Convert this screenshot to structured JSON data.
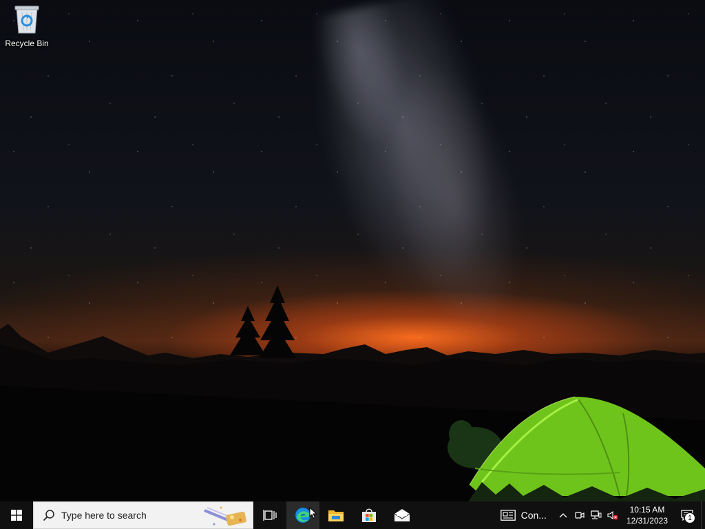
{
  "desktop": {
    "icons": [
      {
        "label": "Recycle Bin",
        "icon": "recycle-bin-icon"
      }
    ]
  },
  "taskbar": {
    "start_icon": "windows-logo-icon",
    "search": {
      "placeholder": "Type here to search",
      "icon": "search-icon"
    },
    "pinned": [
      {
        "name": "Task View",
        "icon": "task-view-icon"
      },
      {
        "name": "Microsoft Edge",
        "icon": "edge-icon",
        "active": true
      },
      {
        "name": "File Explorer",
        "icon": "file-explorer-icon"
      },
      {
        "name": "Microsoft Store",
        "icon": "store-icon"
      },
      {
        "name": "Mail",
        "icon": "mail-icon"
      }
    ],
    "news": {
      "label": "Con...",
      "icon": "news-icon"
    },
    "tray": {
      "clock_time": "10:15 AM",
      "clock_date": "12/31/2023",
      "notification_count": "1"
    }
  },
  "colors": {
    "taskbar": "#101010",
    "search_bg": "#f2f2f2",
    "tent": "#7ed321"
  }
}
